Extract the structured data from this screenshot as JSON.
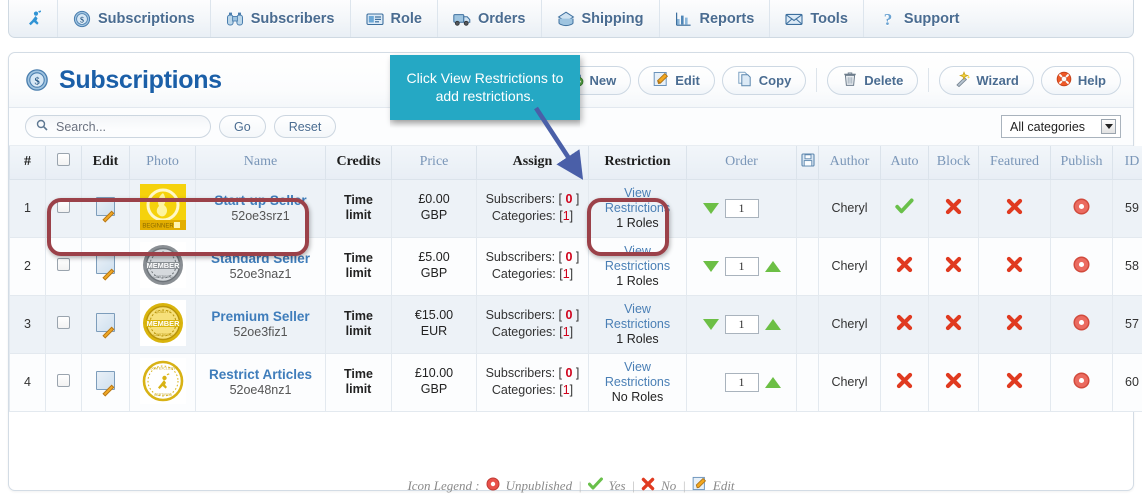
{
  "nav": {
    "items": [
      {
        "label": "",
        "icon": "home-person-icon"
      },
      {
        "label": "Subscriptions",
        "icon": "badge-dollar-icon"
      },
      {
        "label": "Subscribers",
        "icon": "binoculars-icon"
      },
      {
        "label": "Role",
        "icon": "id-card-icon"
      },
      {
        "label": "Orders",
        "icon": "truck-icon"
      },
      {
        "label": "Shipping",
        "icon": "shipping-box-icon"
      },
      {
        "label": "Reports",
        "icon": "bar-chart-icon"
      },
      {
        "label": "Tools",
        "icon": "envelope-icon"
      },
      {
        "label": "Support",
        "icon": "question-mark-icon"
      }
    ]
  },
  "header": {
    "title": "Subscriptions",
    "title_icon": "badge-dollar-icon"
  },
  "toolbar": {
    "buttons": [
      {
        "label": "New",
        "icon": "new-page-plus-icon"
      },
      {
        "label": "Edit",
        "icon": "pencil-edit-icon"
      },
      {
        "label": "Copy",
        "icon": "copy-pages-icon"
      },
      {
        "label": "Delete",
        "icon": "trash-icon"
      },
      {
        "label": "Wizard",
        "icon": "magic-wand-icon"
      },
      {
        "label": "Help",
        "icon": "lifebuoy-icon"
      }
    ]
  },
  "filters": {
    "search_placeholder": "Search...",
    "search_value": "",
    "go_label": "Go",
    "reset_label": "Reset",
    "category_selected": "All categories"
  },
  "callout": {
    "text": "Click View Restrictions to add restrictions.",
    "bg_color": "#25a8c4",
    "text_color": "#ffffff",
    "arrow_color": "#4a5fa8"
  },
  "highlight_color": "#9b4149",
  "table": {
    "columns": [
      {
        "key": "num",
        "label": "#",
        "style": "dark"
      },
      {
        "key": "check",
        "label": "",
        "style": "dark"
      },
      {
        "key": "edit",
        "label": "Edit",
        "style": "dark"
      },
      {
        "key": "photo",
        "label": "Photo",
        "style": "link"
      },
      {
        "key": "name",
        "label": "Name",
        "style": "link"
      },
      {
        "key": "credits",
        "label": "Credits",
        "style": "dark"
      },
      {
        "key": "price",
        "label": "Price",
        "style": "link"
      },
      {
        "key": "assign",
        "label": "Assign",
        "style": "dark"
      },
      {
        "key": "restriction",
        "label": "Restriction",
        "style": "dark"
      },
      {
        "key": "order",
        "label": "Order",
        "style": "link"
      },
      {
        "key": "save",
        "label": "",
        "style": "icon",
        "icon": "floppy-save-icon"
      },
      {
        "key": "author",
        "label": "Author",
        "style": "link"
      },
      {
        "key": "auto",
        "label": "Auto",
        "style": "link"
      },
      {
        "key": "block",
        "label": "Block",
        "style": "link"
      },
      {
        "key": "featured",
        "label": "Featured",
        "style": "link"
      },
      {
        "key": "publish",
        "label": "Publish",
        "style": "link"
      },
      {
        "key": "id",
        "label": "ID",
        "style": "link"
      }
    ],
    "rows": [
      {
        "num": "1",
        "photo_icon": "beginner-badge-yellow",
        "name": "Start-up Seller",
        "alias": "52oe3srz1",
        "credits": "Time limit",
        "price": "£0.00 GBP",
        "subscribers_label": "Subscribers:",
        "subscribers_count": "0",
        "categories_label": "Categories:",
        "categories_count": "1",
        "restriction_link": "View Restrictions",
        "restriction_roles": "1 Roles",
        "order_value": "1",
        "order_down": true,
        "order_up": false,
        "author": "Cheryl",
        "auto": "yes",
        "block": "no",
        "featured": "no",
        "publish": "unpublished",
        "id": "59"
      },
      {
        "num": "2",
        "photo_icon": "member-badge-grey",
        "name": "Standard Seller",
        "alias": "52oe3naz1",
        "credits": "Time limit",
        "price": "£5.00 GBP",
        "subscribers_label": "Subscribers:",
        "subscribers_count": "0",
        "categories_label": "Categories:",
        "categories_count": "1",
        "restriction_link": "View Restrictions",
        "restriction_roles": "1 Roles",
        "order_value": "1",
        "order_down": true,
        "order_up": true,
        "author": "Cheryl",
        "auto": "no",
        "block": "no",
        "featured": "no",
        "publish": "unpublished",
        "id": "58"
      },
      {
        "num": "3",
        "photo_icon": "member-badge-gold",
        "name": "Premium Seller",
        "alias": "52oe3fiz1",
        "credits": "Time limit",
        "price": "€15.00 EUR",
        "subscribers_label": "Subscribers:",
        "subscribers_count": "0",
        "categories_label": "Categories:",
        "categories_count": "1",
        "restriction_link": "View Restrictions",
        "restriction_roles": "1 Roles",
        "order_value": "1",
        "order_down": true,
        "order_up": true,
        "author": "Cheryl",
        "auto": "no",
        "block": "no",
        "featured": "no",
        "publish": "unpublished",
        "id": "57"
      },
      {
        "num": "4",
        "photo_icon": "exclusive-badge-gold",
        "name": "Restrict Articles",
        "alias": "52oe48nz1",
        "credits": "Time limit",
        "price": "£10.00 GBP",
        "subscribers_label": "Subscribers:",
        "subscribers_count": "0",
        "categories_label": "Categories:",
        "categories_count": "1",
        "restriction_link": "View Restrictions",
        "restriction_roles": "No Roles",
        "order_value": "1",
        "order_down": false,
        "order_up": true,
        "author": "Cheryl",
        "auto": "no",
        "block": "no",
        "featured": "no",
        "publish": "unpublished",
        "id": "60"
      }
    ]
  },
  "legend": {
    "title": "Icon Legend :",
    "items": [
      {
        "icon": "unpublished-circle-icon",
        "label": "Unpublished"
      },
      {
        "icon": "green-check-icon",
        "label": "Yes"
      },
      {
        "icon": "red-cross-icon",
        "label": "No"
      },
      {
        "icon": "pencil-edit-icon",
        "label": "Edit"
      }
    ],
    "separator": "|"
  }
}
